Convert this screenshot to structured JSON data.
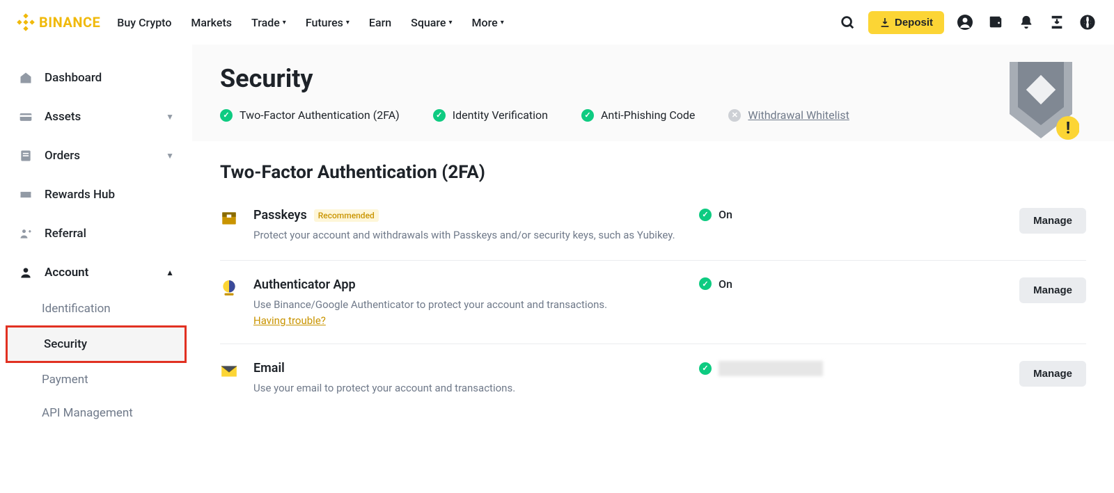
{
  "brand": "BINANCE",
  "nav": {
    "buy": "Buy Crypto",
    "markets": "Markets",
    "trade": "Trade",
    "futures": "Futures",
    "earn": "Earn",
    "square": "Square",
    "more": "More"
  },
  "header": {
    "deposit": "Deposit"
  },
  "sidebar": {
    "dashboard": "Dashboard",
    "assets": "Assets",
    "orders": "Orders",
    "rewards": "Rewards Hub",
    "referral": "Referral",
    "account": "Account",
    "identification": "Identification",
    "security": "Security",
    "payment": "Payment",
    "api": "API Management"
  },
  "page": {
    "title": "Security",
    "checks": {
      "tfa": "Two-Factor Authentication (2FA)",
      "identity": "Identity Verification",
      "phishing": "Anti-Phishing Code",
      "whitelist": "Withdrawal Whitelist"
    }
  },
  "tfa": {
    "heading": "Two-Factor Authentication (2FA)",
    "passkeys": {
      "title": "Passkeys",
      "badge": "Recommended",
      "desc": "Protect your account and withdrawals with Passkeys and/or security keys, such as Yubikey.",
      "status": "On",
      "action": "Manage"
    },
    "authenticator": {
      "title": "Authenticator App",
      "desc": "Use Binance/Google Authenticator to protect your account and transactions.",
      "help": "Having trouble?",
      "status": "On",
      "action": "Manage"
    },
    "email": {
      "title": "Email",
      "desc": "Use your email to protect your account and transactions.",
      "action": "Manage"
    }
  }
}
